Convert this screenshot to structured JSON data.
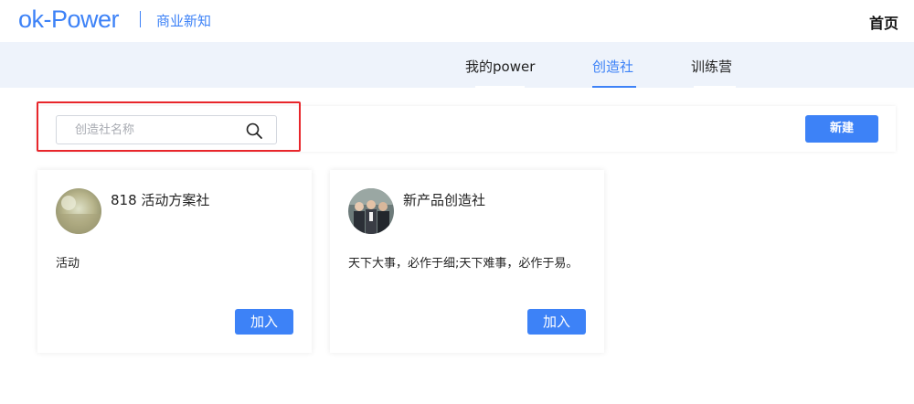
{
  "header": {
    "logo_text": "ok-Power",
    "logo_subtitle": "商业新知",
    "home_label": "首页"
  },
  "tabs": [
    {
      "label": "我的power",
      "active": false
    },
    {
      "label": "创造社",
      "active": true
    },
    {
      "label": "训练营",
      "active": false
    }
  ],
  "search": {
    "placeholder": "创造社名称",
    "value": ""
  },
  "toolbar": {
    "new_label": "新建"
  },
  "cards": [
    {
      "title": "818 活动方案社",
      "description": "活动",
      "join_label": "加入"
    },
    {
      "title": "新产品创造社",
      "description": "天下大事，必作于细;天下难事，必作于易。",
      "join_label": "加入"
    }
  ],
  "colors": {
    "accent": "#3d82f7",
    "tab_band": "#eef3fb",
    "highlight_border": "#e8262b"
  }
}
